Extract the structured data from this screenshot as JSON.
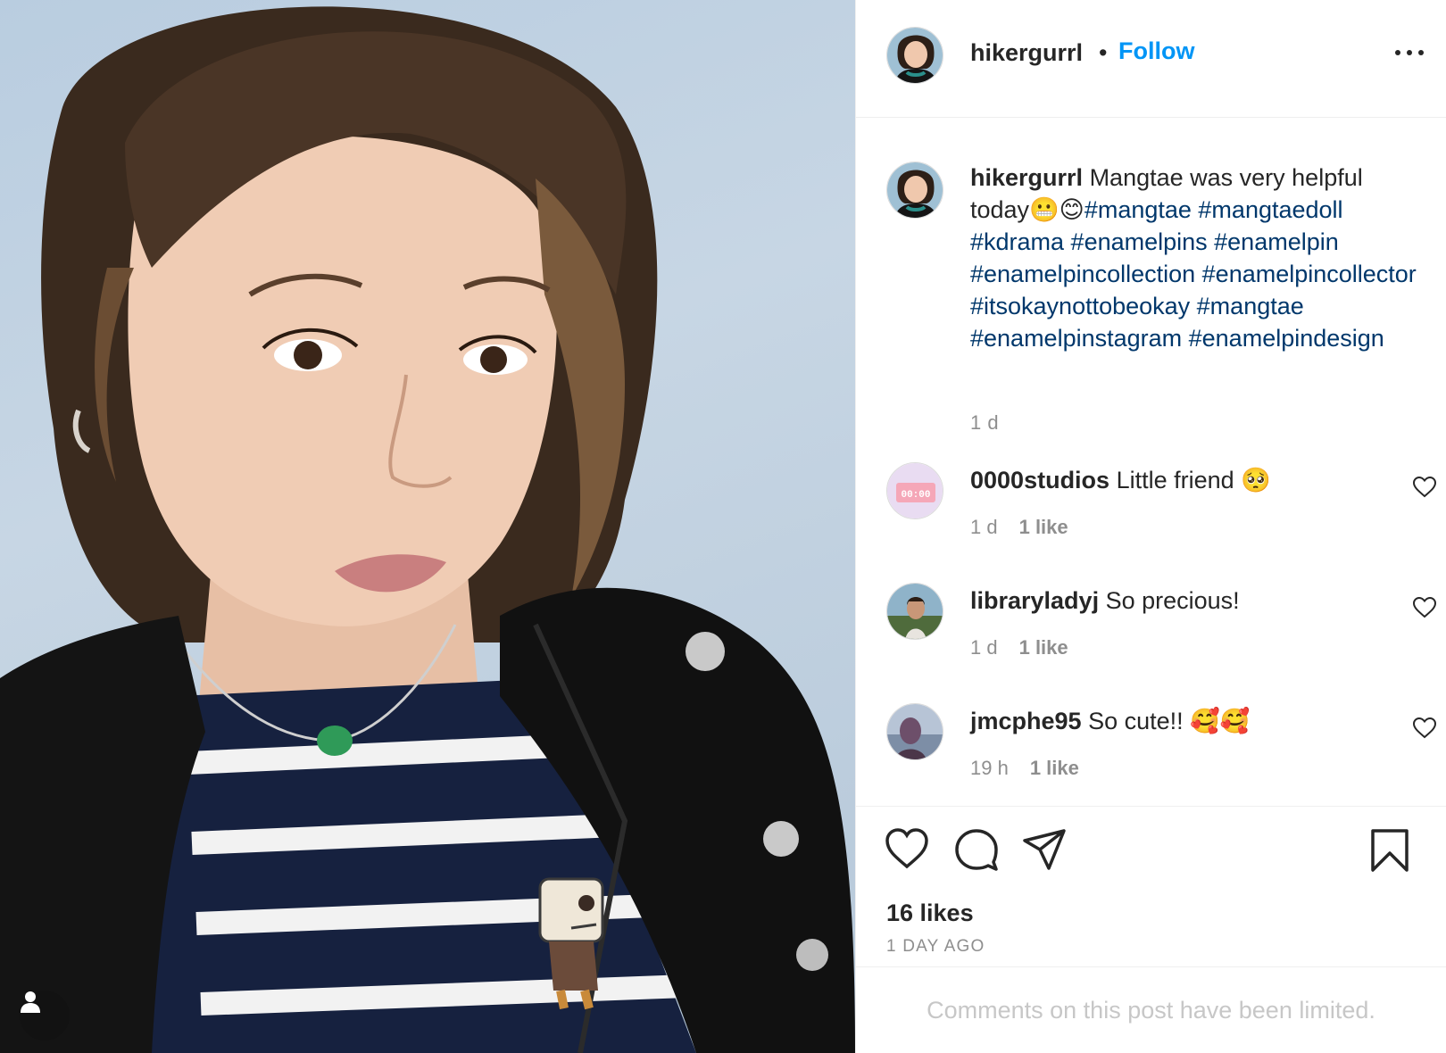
{
  "post": {
    "username": "hikergurrl",
    "separator": "•",
    "follow_label": "Follow",
    "caption_text": "Mangtae was very helpful today😬😊",
    "caption_hashtags": "#mangtae #mangtaedoll #kdrama #enamelpins #enamelpin #enamelpincollection #enamelpincollector #itsokaynottobeokay #mangtae #enamelpinstagram #enamelpindesign",
    "caption_time": "1 d",
    "likes": "16 likes",
    "posted_ago": "1 DAY AGO",
    "comments_notice": "Comments on this post have been limited."
  },
  "comments": [
    {
      "username": "0000studios",
      "text": "Little friend 🥺",
      "time": "1 d",
      "likes": "1 like"
    },
    {
      "username": "libraryladyj",
      "text": "So precious!",
      "time": "1 d",
      "likes": "1 like"
    },
    {
      "username": "jmcphe95",
      "text": "So cute!! 🥰🥰",
      "time": "19 h",
      "likes": "1 like"
    }
  ],
  "avatar_0000studios_text": "00:00",
  "icons": [
    "user-tag-icon",
    "more-options-icon",
    "heart-icon",
    "comment-icon",
    "share-icon",
    "bookmark-icon"
  ],
  "colors": {
    "follow": "#0095f6",
    "hashtag": "#00376b",
    "muted": "#8e8e8e",
    "border": "#efefef"
  }
}
